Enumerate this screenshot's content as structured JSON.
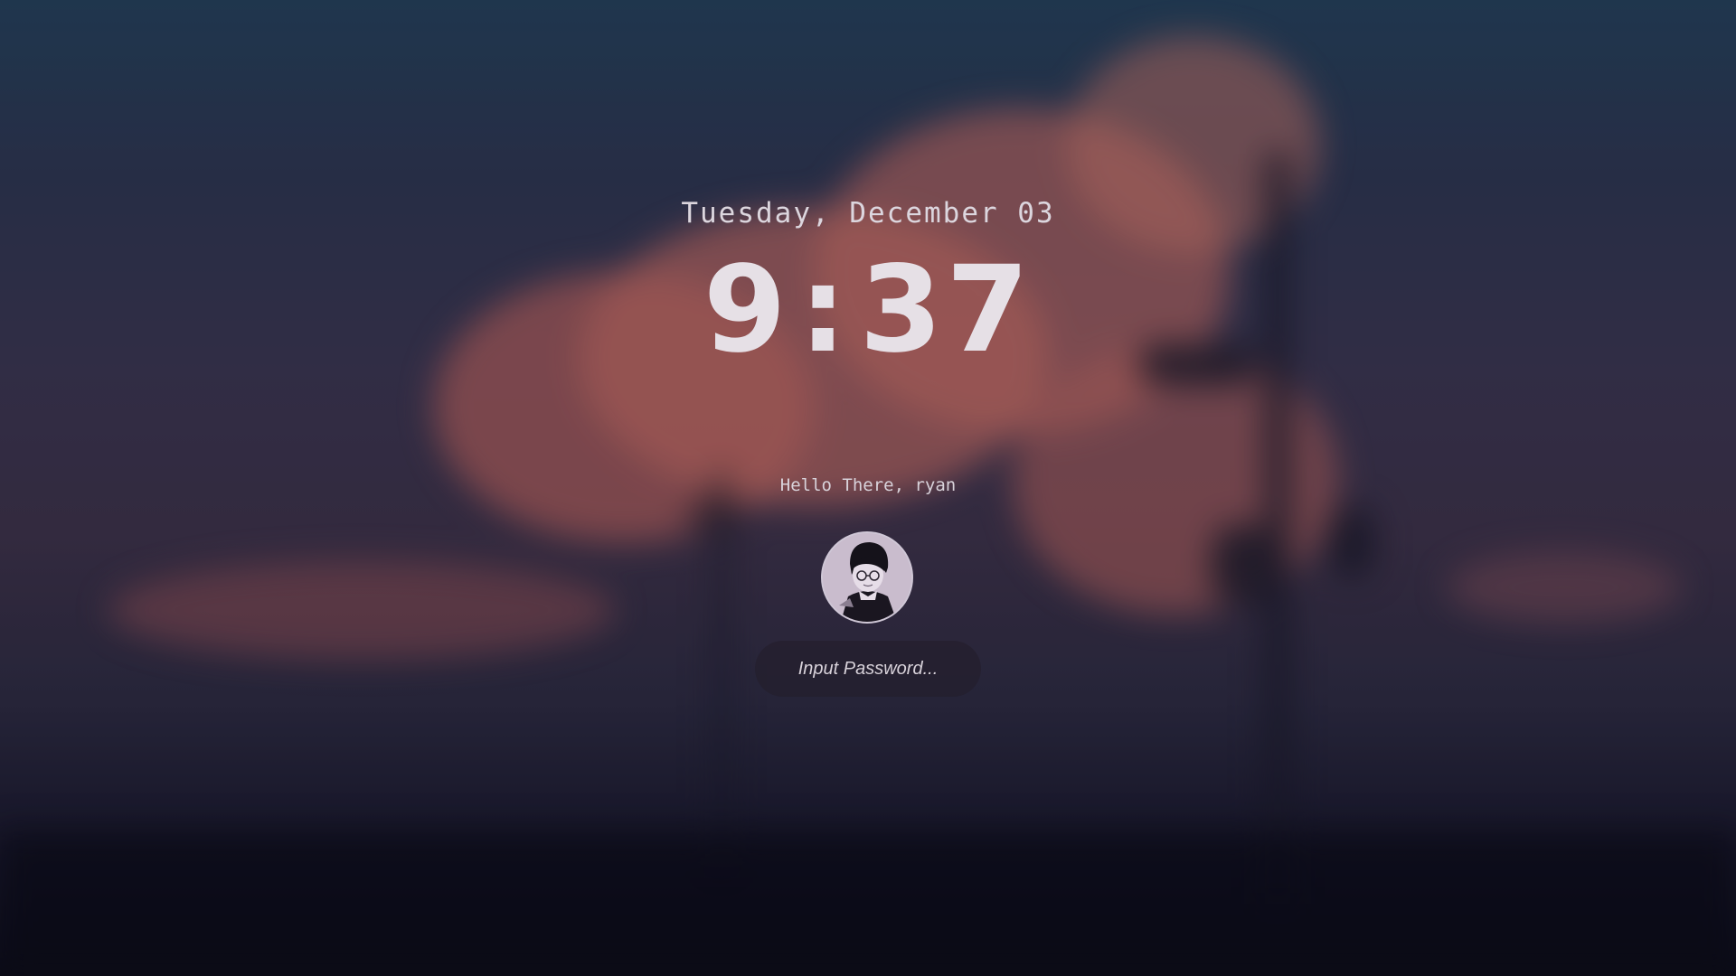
{
  "lockscreen": {
    "date": "Tuesday, December 03",
    "clock": {
      "hours": "9",
      "separator": ":",
      "minutes": "37"
    },
    "greeting": "Hello There, ryan",
    "password": {
      "placeholder": "Input Password...",
      "value": ""
    },
    "avatar": {
      "icon": "user-avatar-icon"
    }
  },
  "colors": {
    "text": "#e6e0e6",
    "input_background": "#241e2c",
    "sky_top": "#24405a",
    "cloud": "#c5665f",
    "ground": "#0c0c18"
  }
}
